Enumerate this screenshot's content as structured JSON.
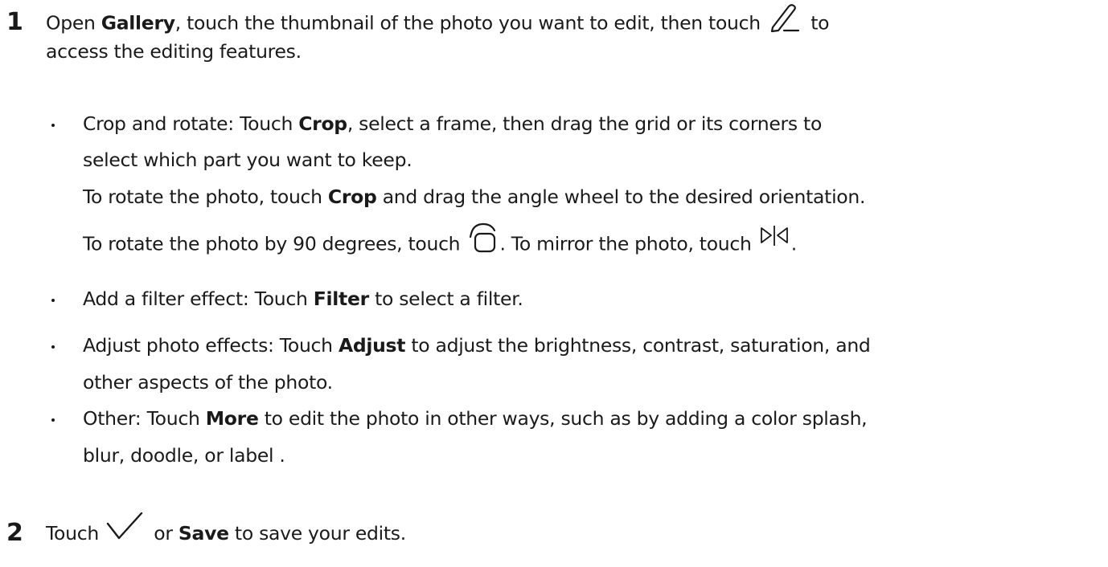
{
  "steps": [
    {
      "number": "1",
      "line1": [
        "Open ",
        "Gallery",
        ", touch the thumbnail of the photo you want to edit, then touch ",
        " to"
      ],
      "line1_icon": "pen-edit-icon",
      "line2": "access the editing features."
    },
    {
      "number": "2",
      "parts": [
        "Touch ",
        " or ",
        "Save",
        " to save your edits."
      ],
      "icon": "checkmark-icon"
    }
  ],
  "bullets": [
    {
      "lines": [
        [
          "Crop and rotate: Touch ",
          "Crop",
          ", select a frame, then drag the grid or its corners to"
        ],
        [
          "select which part you want to keep."
        ],
        [
          "To rotate the photo, touch ",
          "Crop",
          " and drag the angle wheel to the desired orientation."
        ],
        [
          "To rotate the photo by 90 degrees, touch ",
          ". To mirror the photo, touch ",
          "."
        ]
      ],
      "icons": [
        "rotate-icon",
        "mirror-icon"
      ]
    },
    {
      "lines": [
        [
          "Add a filter effect: Touch ",
          "Filter",
          " to select a filter."
        ]
      ]
    },
    {
      "lines": [
        [
          "Adjust photo effects: Touch ",
          "Adjust",
          " to adjust the brightness, contrast, saturation, and"
        ],
        [
          "other aspects of the photo."
        ]
      ]
    },
    {
      "lines": [
        [
          "Other: Touch ",
          "More",
          " to edit the photo in other ways, such as by adding a color splash,"
        ],
        [
          "blur, doodle, or label ."
        ]
      ]
    }
  ]
}
